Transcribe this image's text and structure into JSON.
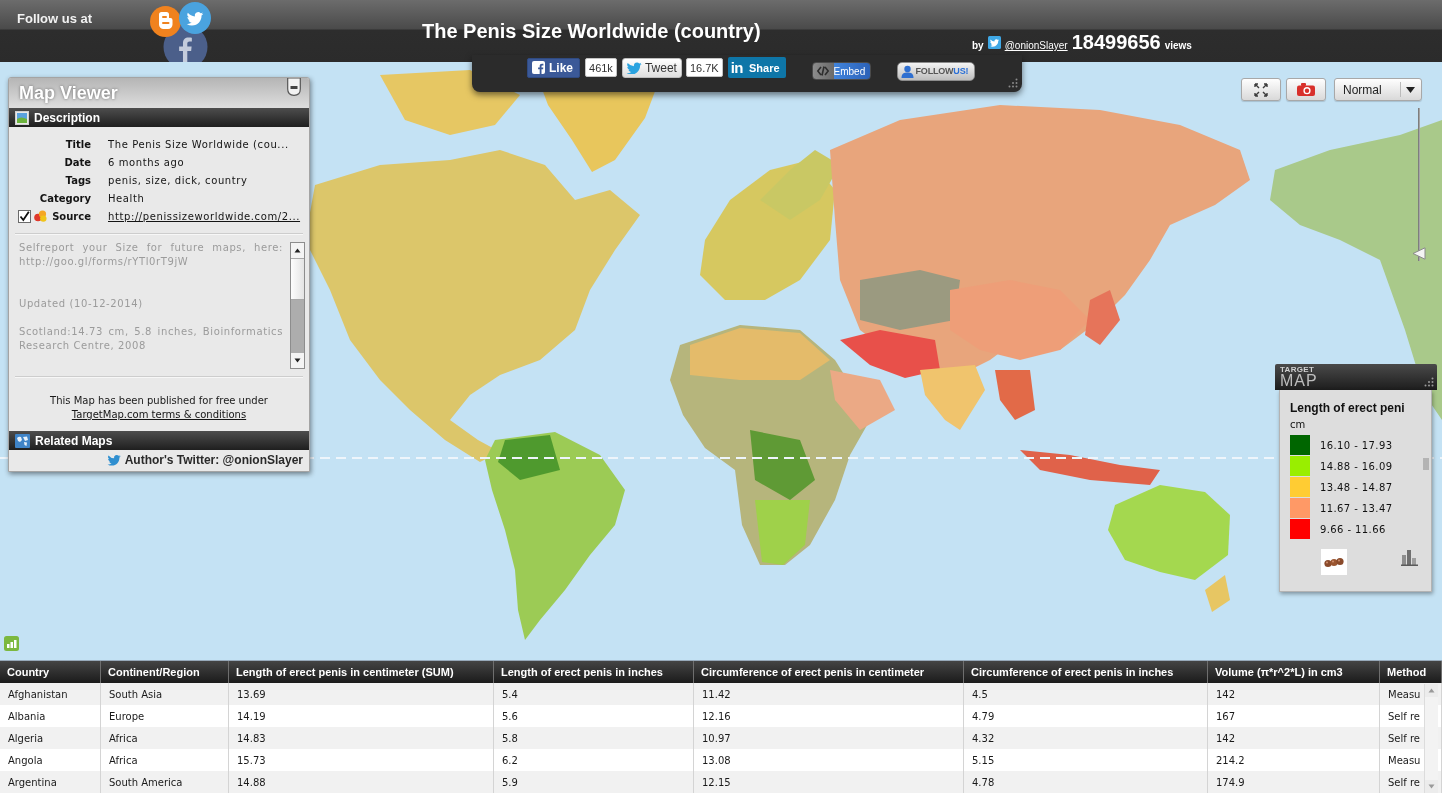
{
  "header": {
    "follow_label": "Follow us at",
    "title": "The Penis Size Worldwide (country)",
    "byline": {
      "prefix": "by",
      "author": "@onionSlayer",
      "views": "18499656",
      "views_label": "views"
    }
  },
  "share_bar": {
    "buttons": [
      {
        "kind": "facebook",
        "label": "Like",
        "count": "461k"
      },
      {
        "kind": "twitter",
        "label": "Tweet",
        "count": "16.7K"
      },
      {
        "kind": "linkedin",
        "logo": "in",
        "label": "Share"
      },
      {
        "kind": "embed",
        "label": "Embed"
      },
      {
        "kind": "follow",
        "label": "FOLLOW",
        "accent": "US!"
      }
    ]
  },
  "map_controls": {
    "view_mode": "Normal",
    "zoom_slider": {
      "level": 0.04
    }
  },
  "map_viewer": {
    "title": "Map Viewer",
    "description_heading": "Description",
    "fields": [
      {
        "label": "Title",
        "value": "The Penis Size Worldwide (cou..."
      },
      {
        "label": "Date",
        "value": "6 months ago"
      },
      {
        "label": "Tags",
        "value": "penis, size, dick, country"
      },
      {
        "label": "Category",
        "value": "Health"
      }
    ],
    "source": {
      "label": "Source",
      "value": "http://penissizeworldwide.com/2...",
      "checked": true
    },
    "notes": [
      "Selfreport your Size for future maps, here: http://goo.gl/forms/rYTl0rT9jW",
      "Updated (10-12-2014)",
      "Scotland:14.73 cm, 5.8 inches, Bioinformatics Research Centre, 2008"
    ],
    "publish_note": "This Map has been published for free under",
    "terms_link": "TargetMap.com terms & conditions",
    "related_heading": "Related Maps",
    "author_twitter": "Author's Twitter: @onionSlayer"
  },
  "legend": {
    "logo": {
      "top": "TARGET",
      "bottom": "MAP"
    },
    "title": "Length of erect peni",
    "unit": "cm",
    "ranges": [
      {
        "label": "16.10 - 17.93",
        "color": "#006600"
      },
      {
        "label": "14.88 - 16.09",
        "color": "#99ee00"
      },
      {
        "label": "13.48 - 14.87",
        "color": "#ffcc33"
      },
      {
        "label": "11.67 - 13.47",
        "color": "#ff9966"
      },
      {
        "label": "9.66 - 11.66",
        "color": "#ff0000"
      }
    ]
  },
  "table": {
    "columns": [
      "Country",
      "Continent/Region",
      "Length of erect penis in centimeter (SUM)",
      "Length of erect penis in inches",
      "Circumference of erect penis in centimeter",
      "Circumference of erect penis in inches",
      "Volume (π*r^2*L) in cm3",
      "Method"
    ],
    "rows": [
      [
        "Afghanistan",
        "South Asia",
        "13.69",
        "5.4",
        "11.42",
        "4.5",
        "142",
        "Measu"
      ],
      [
        "Albania",
        "Europe",
        "14.19",
        "5.6",
        "12.16",
        "4.79",
        "167",
        "Self re"
      ],
      [
        "Algeria",
        "Africa",
        "14.83",
        "5.8",
        "10.97",
        "4.32",
        "142",
        "Self re"
      ],
      [
        "Angola",
        "Africa",
        "15.73",
        "6.2",
        "13.08",
        "5.15",
        "214.2",
        "Measu"
      ],
      [
        "Argentina",
        "South America",
        "14.88",
        "5.9",
        "12.15",
        "4.78",
        "174.9",
        "Self re"
      ]
    ]
  }
}
